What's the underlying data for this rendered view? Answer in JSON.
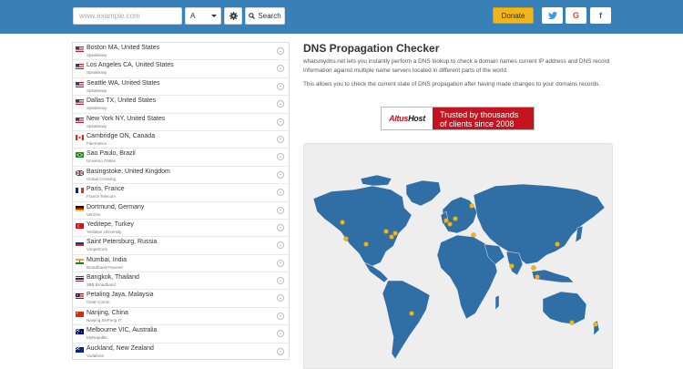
{
  "header": {
    "search_placeholder": "www.example.com",
    "record_type": "A",
    "search_label": "Search",
    "donate_label": "Donate",
    "social": {
      "twitter": "t",
      "google": "G",
      "facebook": "f"
    }
  },
  "servers": [
    {
      "location": "Boston MA, United States",
      "isp": "Speakeasy",
      "flag": "us"
    },
    {
      "location": "Los Angeles CA, United States",
      "isp": "Speakeasy",
      "flag": "us"
    },
    {
      "location": "Seattle WA, United States",
      "isp": "Speakeasy",
      "flag": "us"
    },
    {
      "location": "Dallas TX, United States",
      "isp": "Speakeasy",
      "flag": "us"
    },
    {
      "location": "New York NY, United States",
      "isp": "Speakeasy",
      "flag": "us"
    },
    {
      "location": "Cambridge ON, Canada",
      "isp": "Fibernetics",
      "flag": "ca"
    },
    {
      "location": "Sao Paulo, Brazil",
      "isp": "Universo Online",
      "flag": "br"
    },
    {
      "location": "Basingstoke, United Kingdom",
      "isp": "Global Crossing",
      "flag": "gb"
    },
    {
      "location": "Paris, France",
      "isp": "France Telecom",
      "flag": "fr"
    },
    {
      "location": "Dortmund, Germany",
      "isp": "Verizon",
      "flag": "de"
    },
    {
      "location": "Yeditepe, Turkey",
      "isp": "Yeditepe University",
      "flag": "tr"
    },
    {
      "location": "Saint Petersburg, Russia",
      "isp": "VimpelCom",
      "flag": "ru"
    },
    {
      "location": "Mumbai, India",
      "isp": "Broadband Pacenet",
      "flag": "in"
    },
    {
      "location": "Bangkok, Thailand",
      "isp": "3BB Broadband",
      "flag": "th"
    },
    {
      "location": "Petaling Jaya, Malaysia",
      "isp": "Clear-Comm",
      "flag": "my"
    },
    {
      "location": "Nanjing, China",
      "isp": "Nanjing XinFeng IT",
      "flag": "cn"
    },
    {
      "location": "Melbourne VIC, Australia",
      "isp": "MyRepublic",
      "flag": "au"
    },
    {
      "location": "Auckland, New Zealand",
      "isp": "Vodafone",
      "flag": "nz"
    }
  ],
  "content": {
    "title": "DNS Propagation Checker",
    "intro": "whatsmydns.net lets you instantly perform a DNS lookup to check a domain names current IP address and DNS record information against multiple name servers located in different parts of the world.",
    "intro2": "This allows you to check the current state of DNS propagation after having made changes to your domains records."
  },
  "ad": {
    "logo_a": "Altus",
    "logo_b": "Host",
    "line1": "Trusted by thousands",
    "line2": "of clients since 2008"
  },
  "colors": {
    "header": "#3a80b8",
    "land": "#2f6fa6",
    "marker": "#f0b51a",
    "ad_red": "#c31420"
  }
}
